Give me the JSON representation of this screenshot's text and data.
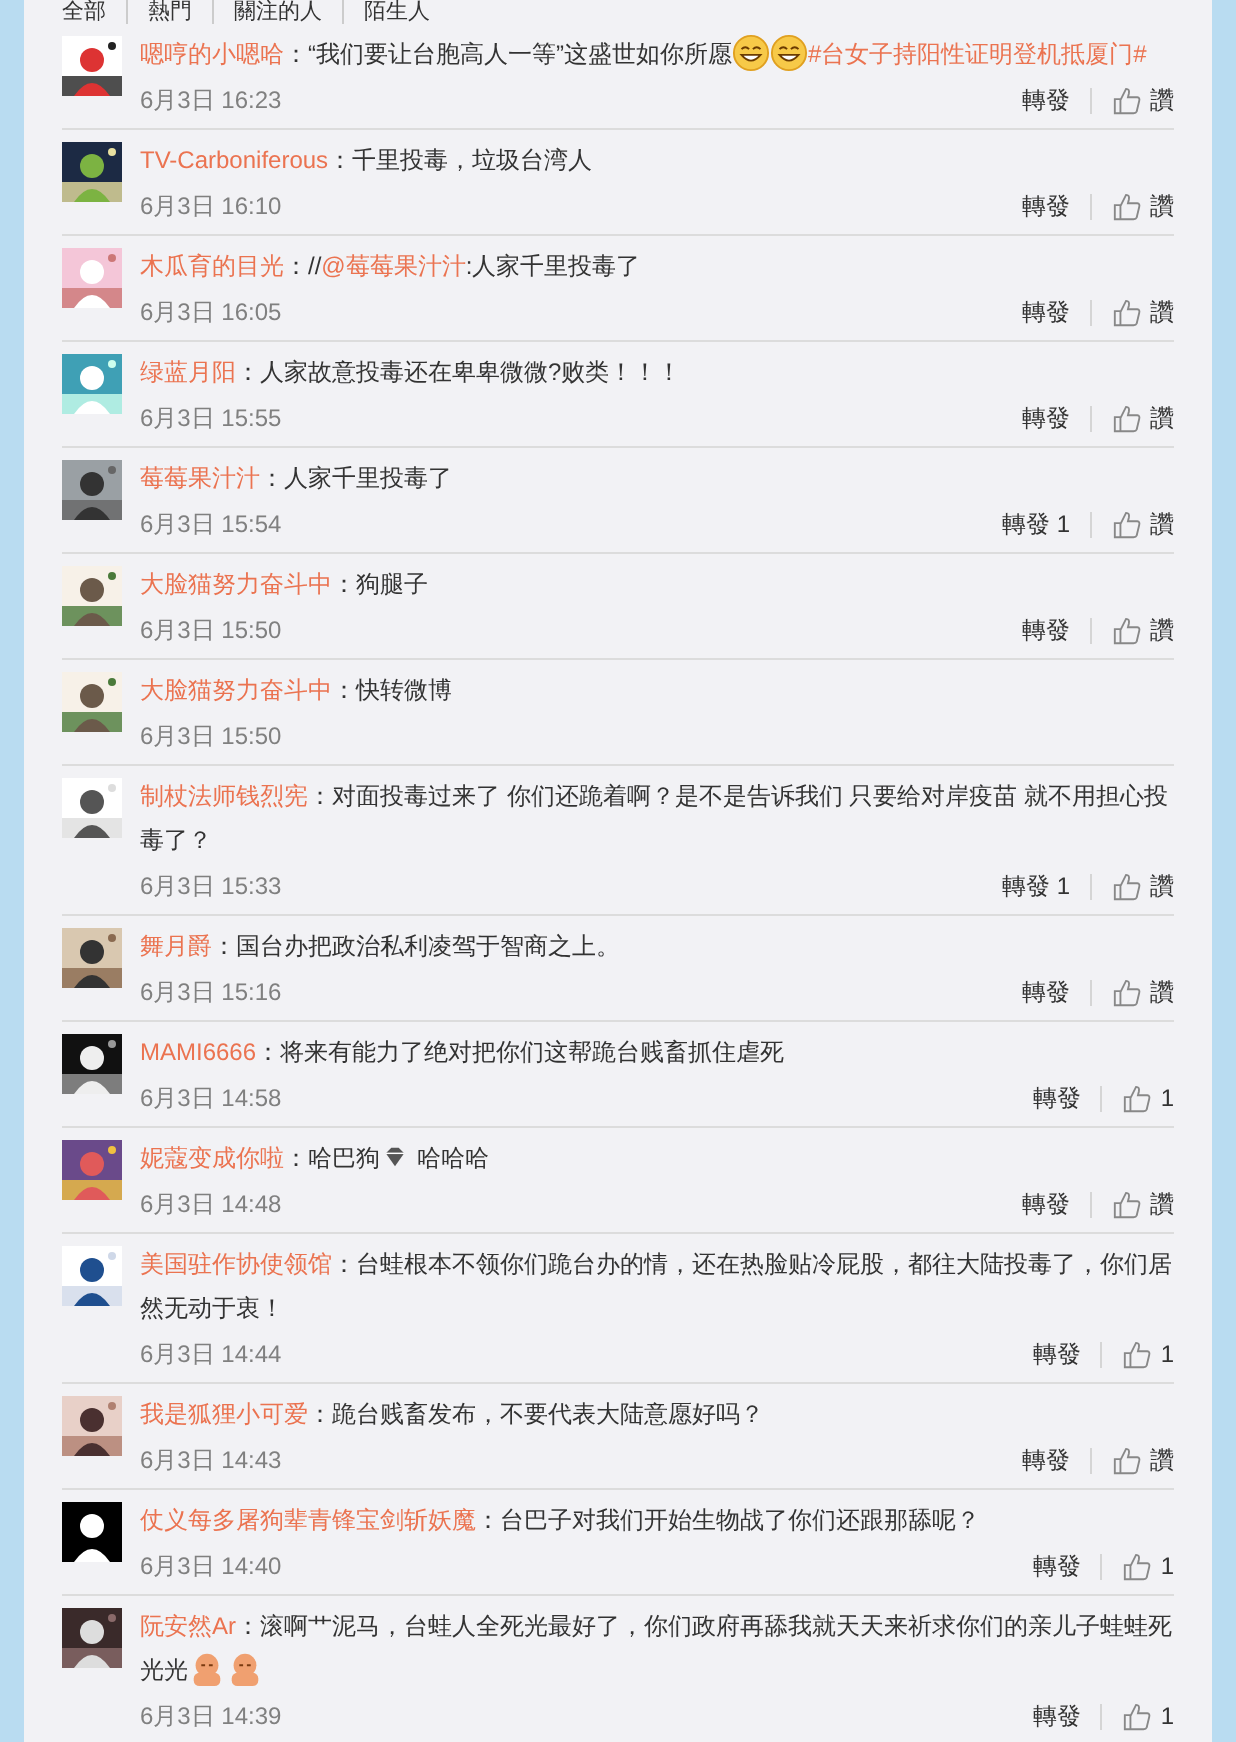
{
  "tabs": [
    {
      "label": "全部"
    },
    {
      "label": "熱門"
    },
    {
      "label": "關注的人"
    },
    {
      "label": "陌生人"
    }
  ],
  "comments": [
    {
      "user": "嗯哼的小嗯哈",
      "segments": [
        {
          "kind": "text",
          "text": "：“我们要让台胞高人一等”这盛世如你所愿"
        },
        {
          "kind": "smiley"
        },
        {
          "kind": "smiley"
        },
        {
          "kind": "link",
          "text": "#台女子持阳性证明登机抵厦门#"
        }
      ],
      "time": "6月3日 16:23",
      "repost": "轉發",
      "like": "讚"
    },
    {
      "user": "TV-Carboniferous",
      "segments": [
        {
          "kind": "text",
          "text": "：千里投毒，垃圾台湾人"
        }
      ],
      "time": "6月3日 16:10",
      "repost": "轉發",
      "like": "讚"
    },
    {
      "user": "木瓜育的目光",
      "segments": [
        {
          "kind": "text",
          "text": "：//"
        },
        {
          "kind": "link",
          "text": "@莓莓果汁汁"
        },
        {
          "kind": "text",
          "text": ":人家千里投毒了"
        }
      ],
      "time": "6月3日 16:05",
      "repost": "轉發",
      "like": "讚"
    },
    {
      "user": "绿蓝月阳",
      "segments": [
        {
          "kind": "text",
          "text": "：人家故意投毒还在卑卑微微?败类！！！"
        }
      ],
      "time": "6月3日 15:55",
      "repost": "轉發",
      "like": "讚"
    },
    {
      "user": "莓莓果汁汁",
      "segments": [
        {
          "kind": "text",
          "text": "：人家千里投毒了"
        }
      ],
      "time": "6月3日 15:54",
      "repost": "轉發",
      "repost_count": "1",
      "like": "讚"
    },
    {
      "user": "大脸猫努力奋斗中",
      "segments": [
        {
          "kind": "text",
          "text": "：狗腿子"
        }
      ],
      "time": "6月3日 15:50",
      "repost": "轉發",
      "like": "讚"
    },
    {
      "user": "大脸猫努力奋斗中",
      "segments": [
        {
          "kind": "text",
          "text": "：快转微博"
        }
      ],
      "time": "6月3日 15:50"
    },
    {
      "user": "制杖法师钱烈宪",
      "segments": [
        {
          "kind": "text",
          "text": "：对面投毒过来了 你们还跪着啊？是不是告诉我们 只要给对岸疫苗 就不用担心投毒了？"
        }
      ],
      "time": "6月3日 15:33",
      "repost": "轉發",
      "repost_count": "1",
      "like": "讚"
    },
    {
      "user": "舞月爵",
      "segments": [
        {
          "kind": "text",
          "text": "：国台办把政治私利凌驾于智商之上。"
        }
      ],
      "time": "6月3日 15:16",
      "repost": "轉發",
      "like": "讚"
    },
    {
      "user": "MAMI6666",
      "segments": [
        {
          "kind": "text",
          "text": "：将来有能力了绝对把你们这帮跪台贱畜抓住虐死"
        }
      ],
      "time": "6月3日 14:58",
      "repost": "轉發",
      "like": "1"
    },
    {
      "user": "妮蔻变成你啦",
      "segments": [
        {
          "kind": "text",
          "text": "：哈巴狗"
        },
        {
          "kind": "sticker"
        },
        {
          "kind": "text",
          "text": " 哈哈哈"
        }
      ],
      "time": "6月3日 14:48",
      "repost": "轉發",
      "like": "讚"
    },
    {
      "user": "美国驻作协使领馆",
      "segments": [
        {
          "kind": "text",
          "text": "：台蛙根本不领你们跪台办的情，还在热脸贴冷屁股，都往大陆投毒了，你们居然无动于衷！"
        }
      ],
      "time": "6月3日 14:44",
      "repost": "轉發",
      "like": "1"
    },
    {
      "user": "我是狐狸小可爱",
      "segments": [
        {
          "kind": "text",
          "text": "：跪台贱畜发布，不要代表大陆意愿好吗？"
        }
      ],
      "time": "6月3日 14:43",
      "repost": "轉發",
      "like": "讚"
    },
    {
      "user": "仗义每多屠狗辈青锋宝剑斩妖魔",
      "segments": [
        {
          "kind": "text",
          "text": "：台巴子对我们开始生物战了你们还跟那舔呢？"
        }
      ],
      "time": "6月3日 14:40",
      "repost": "轉發",
      "like": "1"
    },
    {
      "user": "阮安然Ar",
      "segments": [
        {
          "kind": "text",
          "text": "：滚啊艹泥马，台蛙人全死光最好了，你们政府再舔我就天天来祈求你们的亲儿子蛙蛙死光光"
        },
        {
          "kind": "baby"
        },
        {
          "kind": "baby"
        }
      ],
      "time": "6月3日 14:39",
      "repost": "轉發",
      "like": "1"
    }
  ]
}
